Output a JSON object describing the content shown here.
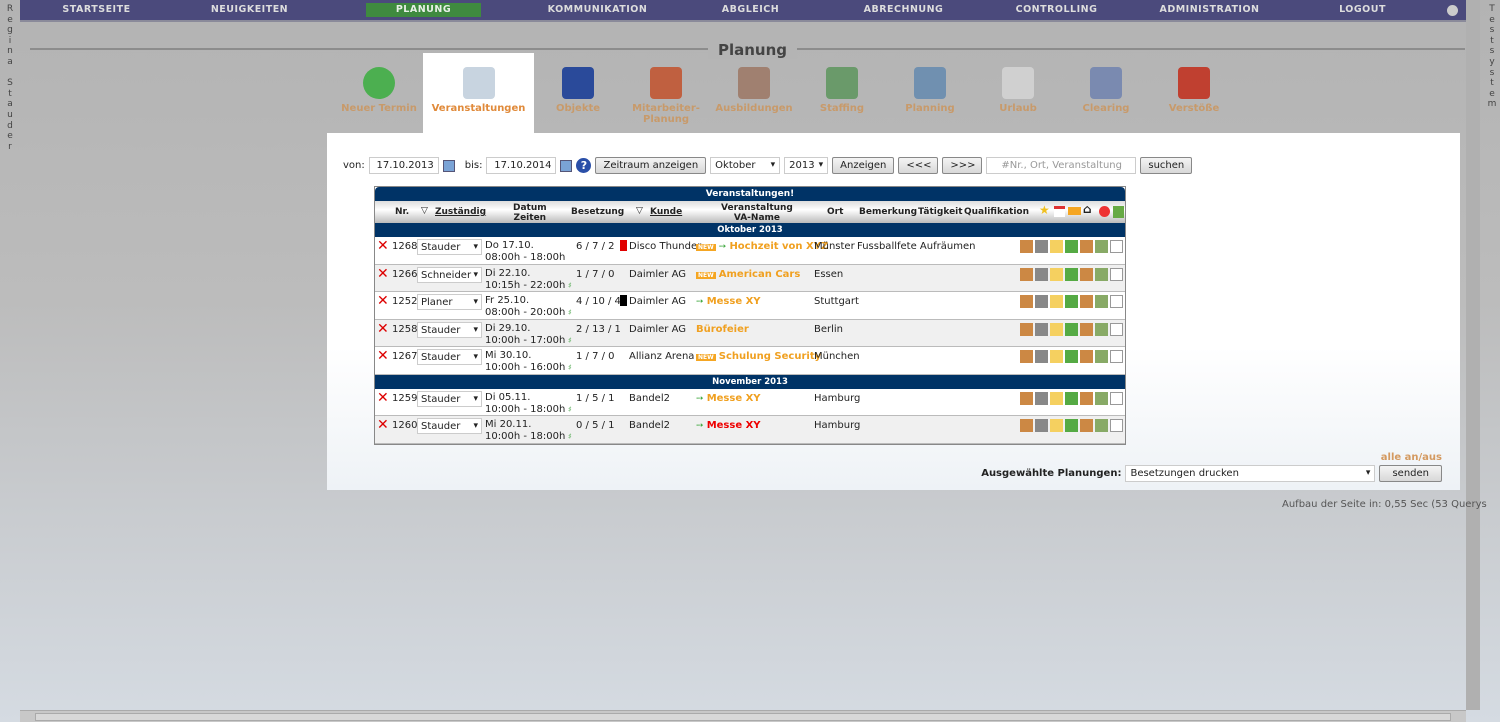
{
  "nav": [
    "STARTSEITE",
    "NEUIGKEITEN",
    "PLANUNG",
    "KOMMUNIKATION",
    "ABGLEICH",
    "ABRECHNUNG",
    "CONTROLLING",
    "ADMINISTRATION",
    "LOGOUT"
  ],
  "nav_active": "PLANUNG",
  "left_user": "Regina Stauder",
  "right_label": "Testsystem",
  "page_title": "Planung",
  "tabs": [
    {
      "label": "Neuer Termin",
      "icon": "plus-icon",
      "color": "#4caf50"
    },
    {
      "label": "Veranstaltungen",
      "icon": "flowchart-icon",
      "color": "#c8d4e0",
      "active": true
    },
    {
      "label": "Objekte",
      "icon": "cube-icon",
      "color": "#2a4a9a"
    },
    {
      "label": "Mitarbeiter-Planung",
      "icon": "people-icon",
      "color": "#c06040"
    },
    {
      "label": "Ausbildungen",
      "icon": "book-icon",
      "color": "#a08070"
    },
    {
      "label": "Staffing",
      "icon": "staffing-icon",
      "color": "#6a9a6a"
    },
    {
      "label": "Planning",
      "icon": "planning-icon",
      "color": "#7090b0"
    },
    {
      "label": "Urlaub",
      "icon": "gantt-icon",
      "color": "#d0d0d0"
    },
    {
      "label": "Clearing",
      "icon": "lamp-icon",
      "color": "#7a8ab0"
    },
    {
      "label": "Verstöße",
      "icon": "violation-icon",
      "color": "#c04030"
    }
  ],
  "filter": {
    "von_label": "von:",
    "von": "17.10.2013",
    "bis_label": "bis:",
    "bis": "17.10.2014",
    "zeitraum": "Zeitraum anzeigen",
    "month": "Oktober",
    "year": "2013",
    "anzeigen": "Anzeigen",
    "prev": "<<<",
    "next": ">>>",
    "search_placeholder": "#Nr., Ort, Veranstaltung",
    "suchen": "suchen"
  },
  "table": {
    "caption": "Veranstaltungen!",
    "headers": {
      "nr": "Nr.",
      "zustaendig": "Zuständig",
      "datum": "Datum",
      "zeiten": "Zeiten",
      "besetzung": "Besetzung",
      "kunde": "Kunde",
      "veranstaltung": "Veranstaltung",
      "vaname": "VA-Name",
      "ort": "Ort",
      "bemerkung": "Bemerkung",
      "taetigkeit": "Tätigkeit",
      "qualifikation": "Qualifikation"
    },
    "groups": [
      {
        "month": "Oktober 2013",
        "rows": [
          {
            "nr": "1268",
            "zust": "Stauder",
            "datum": "Do 17.10.",
            "zeit": "08:00h - 18:00h",
            "bes": "6 / 7 / 2",
            "marker": "#e00000",
            "kunde": "Disco Thunder",
            "new": true,
            "arrow": true,
            "va": "Hochzeit von XYZ",
            "ort": "Münster",
            "bem": "Fussballfete Aufräumen"
          },
          {
            "nr": "1266",
            "zust": "Schneider",
            "datum": "Di 22.10.",
            "zeit": "10:15h - 22:00h",
            "bes": "1 / 7 / 0",
            "kunde": "Daimler AG",
            "new": true,
            "va": "American Cars",
            "ort": "Essen"
          },
          {
            "nr": "1252",
            "zust": "Planer",
            "datum": "Fr 25.10.",
            "zeit": "08:00h - 20:00h",
            "bes": "4 / 10 / 4",
            "marker": "#000000",
            "kunde": "Daimler AG",
            "arrow": true,
            "va": "Messe XY",
            "ort": "Stuttgart"
          },
          {
            "nr": "1258",
            "zust": "Stauder",
            "datum": "Di 29.10.",
            "zeit": "10:00h - 17:00h",
            "bes": "2 / 13 / 1",
            "kunde": "Daimler AG",
            "va": "Bürofeier",
            "ort": "Berlin"
          },
          {
            "nr": "1267",
            "zust": "Stauder",
            "datum": "Mi 30.10.",
            "zeit": "10:00h - 16:00h",
            "bes": "1 / 7 / 0",
            "kunde": "Allianz Arena",
            "new": true,
            "va": "Schulung Security",
            "ort": "München"
          }
        ]
      },
      {
        "month": "November 2013",
        "rows": [
          {
            "nr": "1259",
            "zust": "Stauder",
            "datum": "Di 05.11.",
            "zeit": "10:00h - 18:00h",
            "bes": "1 / 5 / 1",
            "kunde": "Bandel2",
            "arrow": true,
            "va": "Messe XY",
            "ort": "Hamburg"
          },
          {
            "nr": "1260",
            "zust": "Stauder",
            "datum": "Mi 20.11.",
            "zeit": "10:00h - 18:00h",
            "bes": "0 / 5 / 1",
            "kunde": "Bandel2",
            "arrow": true,
            "va": "Messe XY",
            "va_red": true,
            "ort": "Hamburg"
          }
        ]
      }
    ]
  },
  "new_badge": "NEW",
  "alle": "alle an/aus",
  "bottom": {
    "label": "Ausgewählte Planungen:",
    "action": "Besetzungen drucken",
    "send": "senden"
  },
  "perf": "Aufbau der Seite in: 0,55 Sec (53 Querys"
}
